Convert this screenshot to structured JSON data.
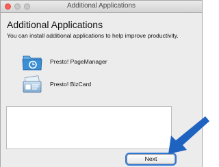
{
  "window": {
    "title": "Additional Applications"
  },
  "main": {
    "heading": "Additional Applications",
    "subtitle": "You can install additional applications to help improve productivity.",
    "apps": [
      {
        "label": "Presto! PageManager",
        "icon": "pagemanager-icon"
      },
      {
        "label": "Presto! BizCard",
        "icon": "bizcard-icon"
      }
    ]
  },
  "footer": {
    "next_label": "Next"
  },
  "colors": {
    "accent": "#2f78d8",
    "arrow": "#1f63c0",
    "close_button": "#fc6058"
  }
}
